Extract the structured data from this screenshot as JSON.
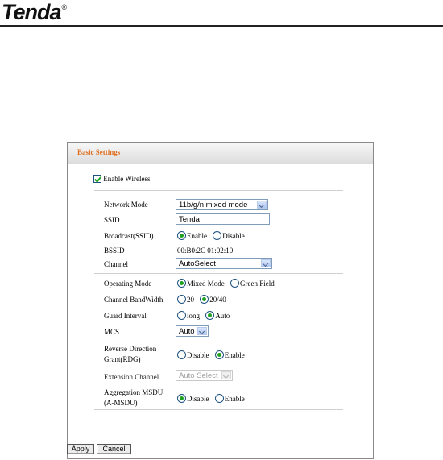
{
  "header": {
    "brand": "Tenda",
    "reg": "®"
  },
  "panel": {
    "title": "Basic Settings",
    "enable_wireless": {
      "label": "Enable Wireless",
      "checked": true
    },
    "network_mode": {
      "label": "Network Mode",
      "value": "11b/g/n mixed mode"
    },
    "ssid": {
      "label": "SSID",
      "value": "Tenda"
    },
    "broadcast": {
      "label": "Broadcast(SSID)",
      "opt1": "Enable",
      "opt2": "Disable",
      "selected": "Enable"
    },
    "bssid": {
      "label": "BSSID",
      "value": "00:B0:2C 01:02:10"
    },
    "channel": {
      "label": "Channel",
      "value": "AutoSelect"
    },
    "operating_mode": {
      "label": "Operating Mode",
      "opt1": "Mixed Mode",
      "opt2": "Green Field",
      "selected": "Mixed Mode"
    },
    "bandwidth": {
      "label": "Channel BandWidth",
      "opt1": "20",
      "opt2": "20/40",
      "selected": "20/40"
    },
    "guard_interval": {
      "label": "Guard Interval",
      "opt1": "long",
      "opt2": "Auto",
      "selected": "Auto"
    },
    "mcs": {
      "label": "MCS",
      "value": "Auto"
    },
    "rdg": {
      "label_line1": "Reverse Direction",
      "label_line2": "Grant(RDG)",
      "opt1": "Disable",
      "opt2": "Enable",
      "selected": "Enable"
    },
    "extension_channel": {
      "label": "Extension Channel",
      "value": "Auto Select"
    },
    "amsdu": {
      "label_line1": "Aggregation MSDU",
      "label_line2": "(A-MSDU)",
      "opt1": "Disable",
      "opt2": "Enable",
      "selected": "Disable"
    }
  },
  "buttons": {
    "apply": "Apply",
    "cancel": "Cancel"
  },
  "colors": {
    "title": "#e07020",
    "radio_dot": "#21a121",
    "border": "#8a8a8a"
  }
}
